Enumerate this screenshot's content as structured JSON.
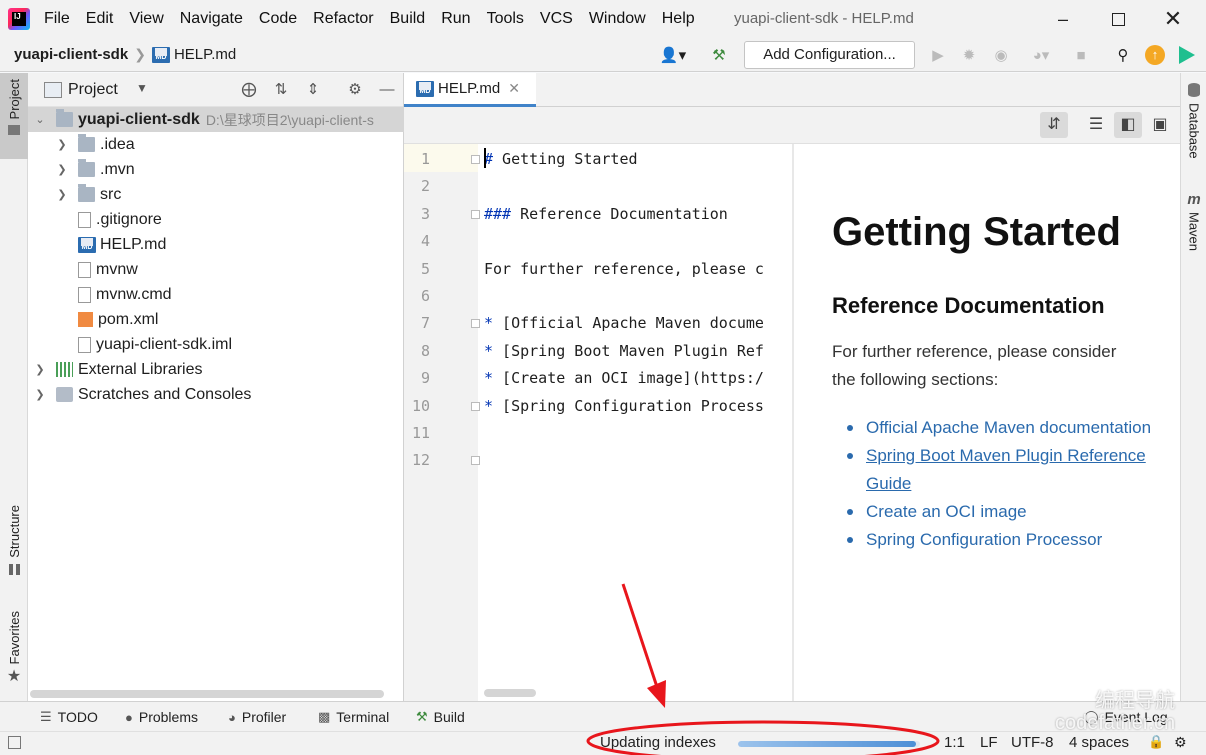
{
  "menubar": {
    "logo_label": "IJ",
    "items": [
      "File",
      "Edit",
      "View",
      "Navigate",
      "Code",
      "Refactor",
      "Build",
      "Run",
      "Tools",
      "VCS",
      "Window",
      "Help"
    ],
    "window_title": "yuapi-client-sdk - HELP.md"
  },
  "navbar": {
    "project": "yuapi-client-sdk",
    "file": "HELP.md",
    "add_configuration": "Add Configuration..."
  },
  "left_stripe": {
    "project": "Project",
    "structure": "Structure",
    "favorites": "Favorites"
  },
  "project_panel": {
    "title": "Project",
    "tree": [
      {
        "label": "yuapi-client-sdk",
        "path": "D:\\星球项目2\\yuapi-client-s",
        "kind": "module",
        "level": 0,
        "expanded": true
      },
      {
        "label": ".idea",
        "kind": "folder",
        "level": 1
      },
      {
        "label": ".mvn",
        "kind": "folder",
        "level": 1
      },
      {
        "label": "src",
        "kind": "folder",
        "level": 1
      },
      {
        "label": ".gitignore",
        "kind": "file",
        "level": 1
      },
      {
        "label": "HELP.md",
        "kind": "md",
        "level": 1
      },
      {
        "label": "mvnw",
        "kind": "file",
        "level": 1
      },
      {
        "label": "mvnw.cmd",
        "kind": "file",
        "level": 1
      },
      {
        "label": "pom.xml",
        "kind": "xml",
        "level": 1
      },
      {
        "label": "yuapi-client-sdk.iml",
        "kind": "file",
        "level": 1
      },
      {
        "label": "External Libraries",
        "kind": "libs",
        "level": 0
      },
      {
        "label": "Scratches and Consoles",
        "kind": "scratch",
        "level": 0
      }
    ]
  },
  "editor": {
    "tab_label": "HELP.md",
    "md_badge": "MD",
    "lines": [
      {
        "n": "1",
        "hash": "#",
        "text": " Getting Started"
      },
      {
        "n": "2",
        "hash": "",
        "text": ""
      },
      {
        "n": "3",
        "hash": "###",
        "text": " Reference Documentation"
      },
      {
        "n": "4",
        "hash": "",
        "text": ""
      },
      {
        "n": "5",
        "hash": "",
        "text": "For further reference, please c"
      },
      {
        "n": "6",
        "hash": "",
        "text": ""
      },
      {
        "n": "7",
        "hash": "*",
        "text": " [Official Apache Maven docume"
      },
      {
        "n": "8",
        "hash": "*",
        "text": " [Spring Boot Maven Plugin Ref"
      },
      {
        "n": "9",
        "hash": "*",
        "text": " [Create an OCI image](https:/"
      },
      {
        "n": "10",
        "hash": "*",
        "text": " [Spring Configuration Process"
      },
      {
        "n": "11",
        "hash": "",
        "text": ""
      },
      {
        "n": "12",
        "hash": "",
        "text": ""
      }
    ]
  },
  "preview": {
    "h1": "Getting Started",
    "h3": "Reference Documentation",
    "paragraph": "For further reference, please consider the following sections:",
    "links": [
      {
        "text": "Official Apache Maven documentation",
        "underlined": false
      },
      {
        "text": "Spring Boot Maven Plugin Reference Guide",
        "underlined": true
      },
      {
        "text": "Create an OCI image",
        "underlined": false
      },
      {
        "text": "Spring Configuration Processor",
        "underlined": false
      }
    ]
  },
  "right_stripe": {
    "database": "Database",
    "maven": "Maven"
  },
  "bottom_tools": {
    "todo": "TODO",
    "problems": "Problems",
    "profiler": "Profiler",
    "terminal": "Terminal",
    "build": "Build",
    "event_log": "Event Log"
  },
  "statusbar": {
    "indexing": "Updating indexes",
    "progress": 0.98,
    "position": "1:1",
    "line_sep": "LF",
    "encoding": "UTF-8",
    "indent": "4 spaces"
  },
  "watermark": {
    "line1": "编程导航",
    "line2": "codefather.cn"
  },
  "colors": {
    "annotation": "#e8161c",
    "link": "#2a6aad",
    "accent": "#4083c9"
  }
}
